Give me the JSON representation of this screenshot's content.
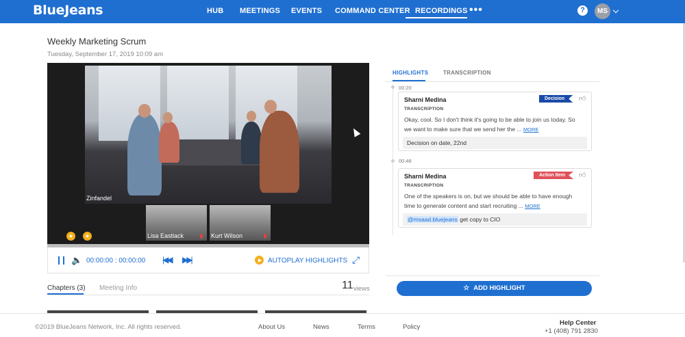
{
  "header": {
    "logo": "BlueJeans",
    "nav": [
      "HUB",
      "MEETINGS",
      "EVENTS",
      "COMMAND CENTER",
      "RECORDINGS"
    ],
    "active_nav": "RECORDINGS",
    "more": "•••",
    "help": "?",
    "avatar_initials": "MS"
  },
  "recording": {
    "title": "Weekly Marketing Scrum",
    "date": "Tuesday, September 17, 2019 10:09 am"
  },
  "video": {
    "main_speaker": "Zinfandel",
    "thumbnails": [
      "Lisa Eastlack",
      "Kurt Wilson"
    ],
    "time": "00:00:00 : 00:00:00",
    "autoplay_label": "AUTOPLAY HIGHLIGHTS",
    "star_glyph": "★"
  },
  "below_tabs": {
    "chapters": "Chapters (3)",
    "meeting_info": "Meeting Info",
    "views_count": "11",
    "views_label": "views"
  },
  "panel": {
    "tabs": [
      "HIGHLIGHTS",
      "TRANSCRIPTION"
    ],
    "active_tab": "HIGHLIGHTS",
    "highlights": [
      {
        "timestamp": "00:20",
        "speaker": "Sharni Medina",
        "tag": "Decision",
        "subtitle": "TRANSCRIPTION",
        "text": "Okay, cool. So I don't think it's going to be able to join us today. So we want to make sure that we send her the ...",
        "more": "MORE",
        "note": "Decision on date, 22nd"
      },
      {
        "timestamp": "00:46",
        "speaker": "Sharni Medina",
        "tag": "Action Item",
        "subtitle": "TRANSCRIPTION",
        "text": "One of the speakers is on, but we should be able to have enough time to generate content and start recruiting ...",
        "more": "MORE",
        "note_mention": "@msaad.bluejeans",
        "note_rest": " get copy to CIO"
      }
    ],
    "add_button": "ADD HIGHLIGHT",
    "add_star": "☆"
  },
  "footer": {
    "copyright": "©2019 BlueJeans Network, Inc. All rights reserved.",
    "links": [
      "About Us",
      "News",
      "Terms",
      "Policy"
    ],
    "help_center": "Help Center",
    "phone": "+1 (408) 791 2830"
  },
  "colors": {
    "brand_blue": "#1f6fd1",
    "decision_tag": "#1a4aa8",
    "action_tag": "#e0515a",
    "highlight_marker": "#f2b01e"
  }
}
